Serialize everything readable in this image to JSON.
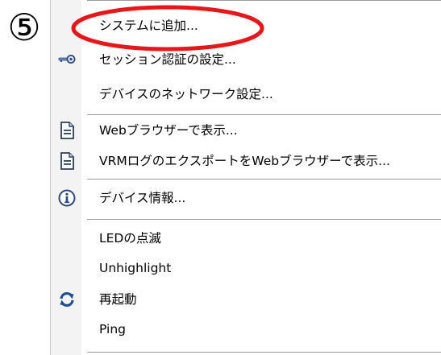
{
  "step_marker": "⑤",
  "menu": {
    "items": [
      {
        "label": "システムに追加...",
        "icon": ""
      },
      {
        "label": "セッション認証の設定...",
        "icon": "key-icon"
      },
      {
        "label": "デバイスのネットワーク設定...",
        "icon": ""
      },
      {
        "label": "Webブラウザーで表示...",
        "icon": "document-icon"
      },
      {
        "label": "VRMログのエクスポートをWebブラウザーで表示...",
        "icon": "document-icon"
      },
      {
        "label": "デバイス情報...",
        "icon": "info-icon"
      },
      {
        "label": "LEDの点滅",
        "icon": ""
      },
      {
        "label": "Unhighlight",
        "icon": ""
      },
      {
        "label": "再起動",
        "icon": "refresh-icon"
      },
      {
        "label": "Ping",
        "icon": ""
      }
    ]
  },
  "colors": {
    "highlight_oval": "#e8161a",
    "separator": "#9a9a9a",
    "icon_gutter": "#f3f3f3",
    "refresh_icon": "#1e4f92",
    "info_icon": "#2a4a7a"
  }
}
